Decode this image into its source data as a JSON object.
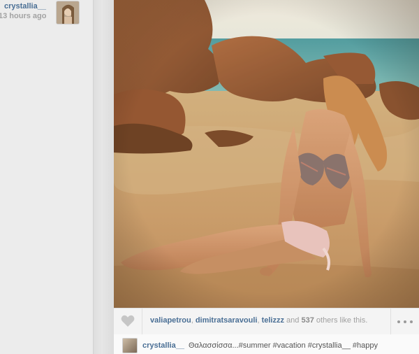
{
  "post": {
    "username": "crystallia__",
    "time_ago": "13 hours ago",
    "likes": {
      "users": [
        "valiapetrou",
        "dimitratsaravouli",
        "telizzz"
      ],
      "separator": ",",
      "and_word": "and",
      "count": "537",
      "suffix": "others like this."
    },
    "caption": {
      "username": "crystallia__",
      "text": "Θαλασσίσσα...#summer #vacation #crystallia__ #happy"
    },
    "icons": {
      "like": "heart-icon",
      "more": "more-options-icon"
    }
  },
  "colors": {
    "username_link": "#4a6f95",
    "muted_text": "#a0a0a0"
  }
}
